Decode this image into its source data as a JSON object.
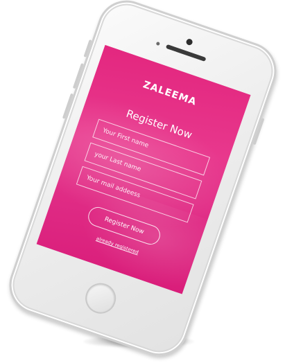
{
  "app": {
    "brand": "ZALEEMA",
    "title": "Register Now"
  },
  "form": {
    "first_name_placeholder": "Your First name",
    "last_name_placeholder": "your Last name",
    "email_placeholder": "Your mail addeess",
    "submit_label": "Register Now",
    "already_registered_link": "already registered"
  },
  "colors": {
    "accent": "#E3277F",
    "text_on_accent": "#FFFFFF"
  },
  "device": {
    "type": "smartphone",
    "finish": "silver"
  }
}
